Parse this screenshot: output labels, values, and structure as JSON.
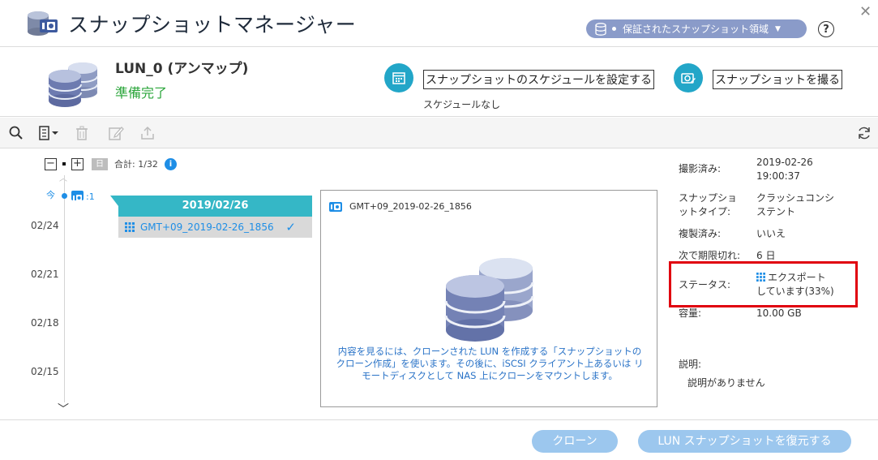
{
  "window": {
    "title": "スナップショットマネージャー",
    "pool_selector": "保証されたスナップショット領域"
  },
  "lun": {
    "name": "LUN_0 (アンマップ)",
    "status": "準備完了",
    "schedule_button": "スナップショットのスケジュールを設定する",
    "schedule_note": "スケジュールなし",
    "take_button": "スナップショットを撮る"
  },
  "timeline": {
    "total": "合計: 1/32",
    "day_label": "日",
    "now_label": "今",
    "now_count": ":1",
    "dates": [
      "02/24",
      "02/21",
      "02/18",
      "02/15"
    ]
  },
  "snapshot_list": {
    "date": "2019/02/26",
    "items": [
      {
        "name": "GMT+09_2019-02-26_1856"
      }
    ]
  },
  "preview": {
    "title": "GMT+09_2019-02-26_1856",
    "message": "内容を見るには、クローンされた LUN を作成する「スナップショットのクローン作成」を使います。その後に、iSCSI クライアント上あるいは リモートディスクとして NAS 上にクローンをマウントします。"
  },
  "details": {
    "taken_label": "撮影済み:",
    "taken_date": "2019-02-26",
    "taken_time": "19:00:37",
    "type_label_1": "スナップショ",
    "type_label_2": "ットタイプ:",
    "type_value_1": "クラッシュコンシ",
    "type_value_2": "ステント",
    "replicated_label": "複製済み:",
    "replicated_value": "いいえ",
    "expire_label": "次で期限切れ:",
    "expire_value": "6 日",
    "status_label": "ステータス:",
    "status_value_1": "エクスポート",
    "status_value_2": "しています(33%)",
    "capacity_label": "容量:",
    "capacity_value": "10.00 GB",
    "description_label": "説明:",
    "description_value": "説明がありません"
  },
  "footer": {
    "clone_button": "クローン",
    "restore_button": "LUN スナップショットを復元する"
  },
  "colors": {
    "accent": "#22a6c8",
    "link": "#1e8ee6",
    "ok": "#2aa53a",
    "highlight": "#e0000f",
    "button": "#9cc7ee"
  }
}
